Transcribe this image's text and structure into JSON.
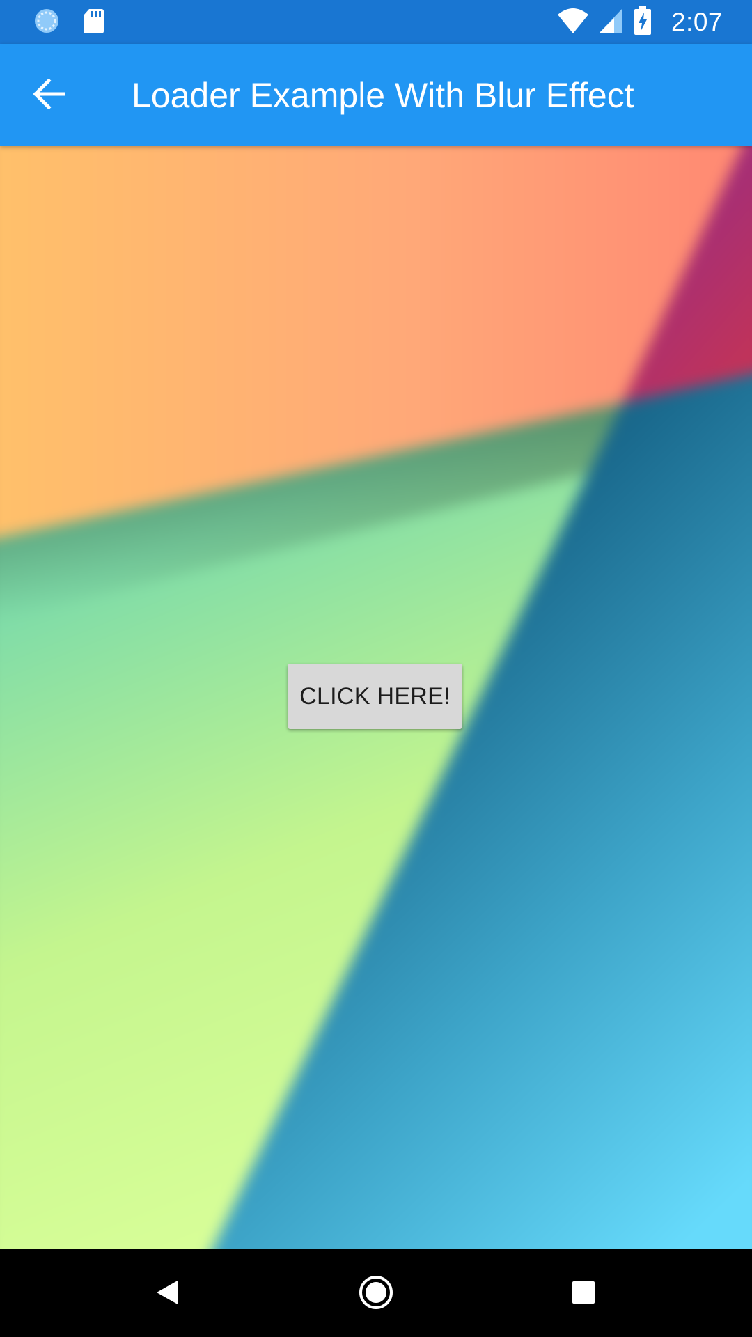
{
  "status_bar": {
    "time": "2:07",
    "icons": [
      "loading-circle-icon",
      "sd-card-icon",
      "wifi-icon",
      "cell-signal-icon",
      "battery-charging-icon"
    ],
    "background": "#1976D2"
  },
  "app_bar": {
    "title": "Loader Example With Blur Effect",
    "back_icon": "arrow-back-icon",
    "background": "#2196F3"
  },
  "content": {
    "background": "blurred-wallpaper",
    "button_label": "CLICK HERE!"
  },
  "nav_bar": {
    "icons": [
      "back-triangle-icon",
      "home-circle-icon",
      "recents-square-icon"
    ]
  }
}
